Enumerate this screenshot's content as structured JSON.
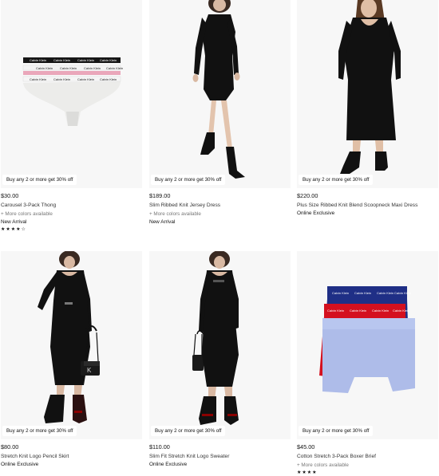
{
  "promo_text": "Buy any 2 or more get 30% off",
  "products": [
    {
      "price": "$30.00",
      "name": "Carousel 3-Pack Thong",
      "more_colors": "+ More colors available",
      "tag": "New Arrival",
      "rating": 4.5,
      "stars_text": "★★★★☆",
      "image": "three-thongs-image",
      "brand_text": "Calvin Klein"
    },
    {
      "price": "$189.00",
      "name": "Slim Ribbed Knit Jersey Dress",
      "more_colors": "+ More colors available",
      "tag": "New Arrival",
      "image": "black-ribbed-dress-model"
    },
    {
      "price": "$220.00",
      "name": "Plus Size Ribbed Knit Blend Scoopneck Maxi Dress",
      "tag": "Online Exclusive",
      "image": "black-maxi-dress-model"
    },
    {
      "price": "$80.00",
      "name": "Stretch Knit Logo Pencil Skirt",
      "tag": "Online Exclusive",
      "image": "black-logo-skirt-model-with-bag"
    },
    {
      "price": "$110.00",
      "name": "Slim Fit Stretch Knit Logo Sweater",
      "tag": "Online Exclusive",
      "image": "black-logo-sweater-model-with-bag"
    },
    {
      "price": "$45.00",
      "name": "Cotton Stretch 3-Pack Boxer Brief",
      "more_colors": "+ More colors available",
      "rating": 4,
      "stars_text": "★★★★",
      "image": "three-boxer-briefs-image",
      "brand_text": "Calvin Klein"
    }
  ],
  "colors": {
    "image_bg": "#f7f7f7",
    "thong_black": "#111111",
    "thong_pink": "#f2b8c6",
    "thong_grey": "#e8e8e6",
    "boxer_navy": "#1f2f86",
    "boxer_red": "#d4101f",
    "boxer_lightblue": "#aebce9"
  }
}
